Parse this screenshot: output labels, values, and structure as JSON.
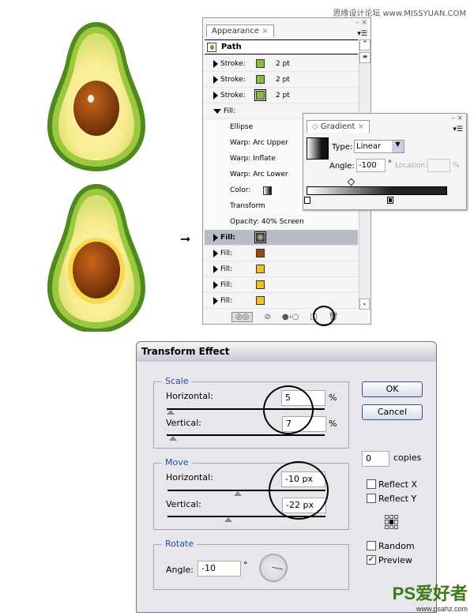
{
  "watermarks": {
    "top": "思缘设计论坛 www.MISSYUAN.COM",
    "bottom_logo": "PS爱好者",
    "bottom_url": "www.psahz.com"
  },
  "appearance": {
    "tab": "Appearance",
    "close": "×",
    "header": "Path",
    "rows": [
      {
        "label": "Stroke:",
        "swatch": "#8cb848",
        "value": "2 pt"
      },
      {
        "label": "Stroke:",
        "swatch": "#8cb848",
        "value": "2 pt"
      },
      {
        "label": "Stroke:",
        "swatch": "#8cb848",
        "value": "2 pt"
      },
      {
        "label": "Fill:"
      }
    ],
    "sub_items": [
      "Ellipse",
      "Warp: Arc Upper",
      "Warp: Inflate",
      "Warp: Arc Lower",
      "Color:",
      "Transform",
      "Opacity: 40% Screen"
    ],
    "fills": [
      {
        "label": "Fill:",
        "swatch": "#5a3a1a",
        "selected": true
      },
      {
        "label": "Fill:",
        "swatch": "#9a4a10"
      },
      {
        "label": "Fill:",
        "swatch": "#f2c020"
      },
      {
        "label": "Fill:",
        "swatch": "#f2c020"
      },
      {
        "label": "Fill:",
        "swatch": "#f2c020"
      }
    ]
  },
  "gradient": {
    "tab": "Gradient",
    "close": "×",
    "type_label": "Type:",
    "type_value": "Linear",
    "angle_label": "Angle:",
    "angle_value": "-100",
    "degree": "°",
    "location_label": "Location:",
    "location_unit": "%"
  },
  "transform": {
    "title": "Transform Effect",
    "scale": {
      "title": "Scale",
      "h_label": "Horizontal:",
      "h_value": "5",
      "v_label": "Vertical:",
      "v_value": "7",
      "unit": "%"
    },
    "move": {
      "title": "Move",
      "h_label": "Horizontal:",
      "h_value": "-10 px",
      "v_label": "Vertical:",
      "v_value": "-22 px"
    },
    "rotate": {
      "title": "Rotate",
      "angle_label": "Angle:",
      "angle_value": "-10",
      "degree": "°"
    },
    "ok": "OK",
    "cancel": "Cancel",
    "copies_value": "0",
    "copies_label": "copies",
    "reflect_x": "Reflect X",
    "reflect_y": "Reflect Y",
    "random": "Random",
    "preview": "Preview",
    "preview_checked": true
  }
}
